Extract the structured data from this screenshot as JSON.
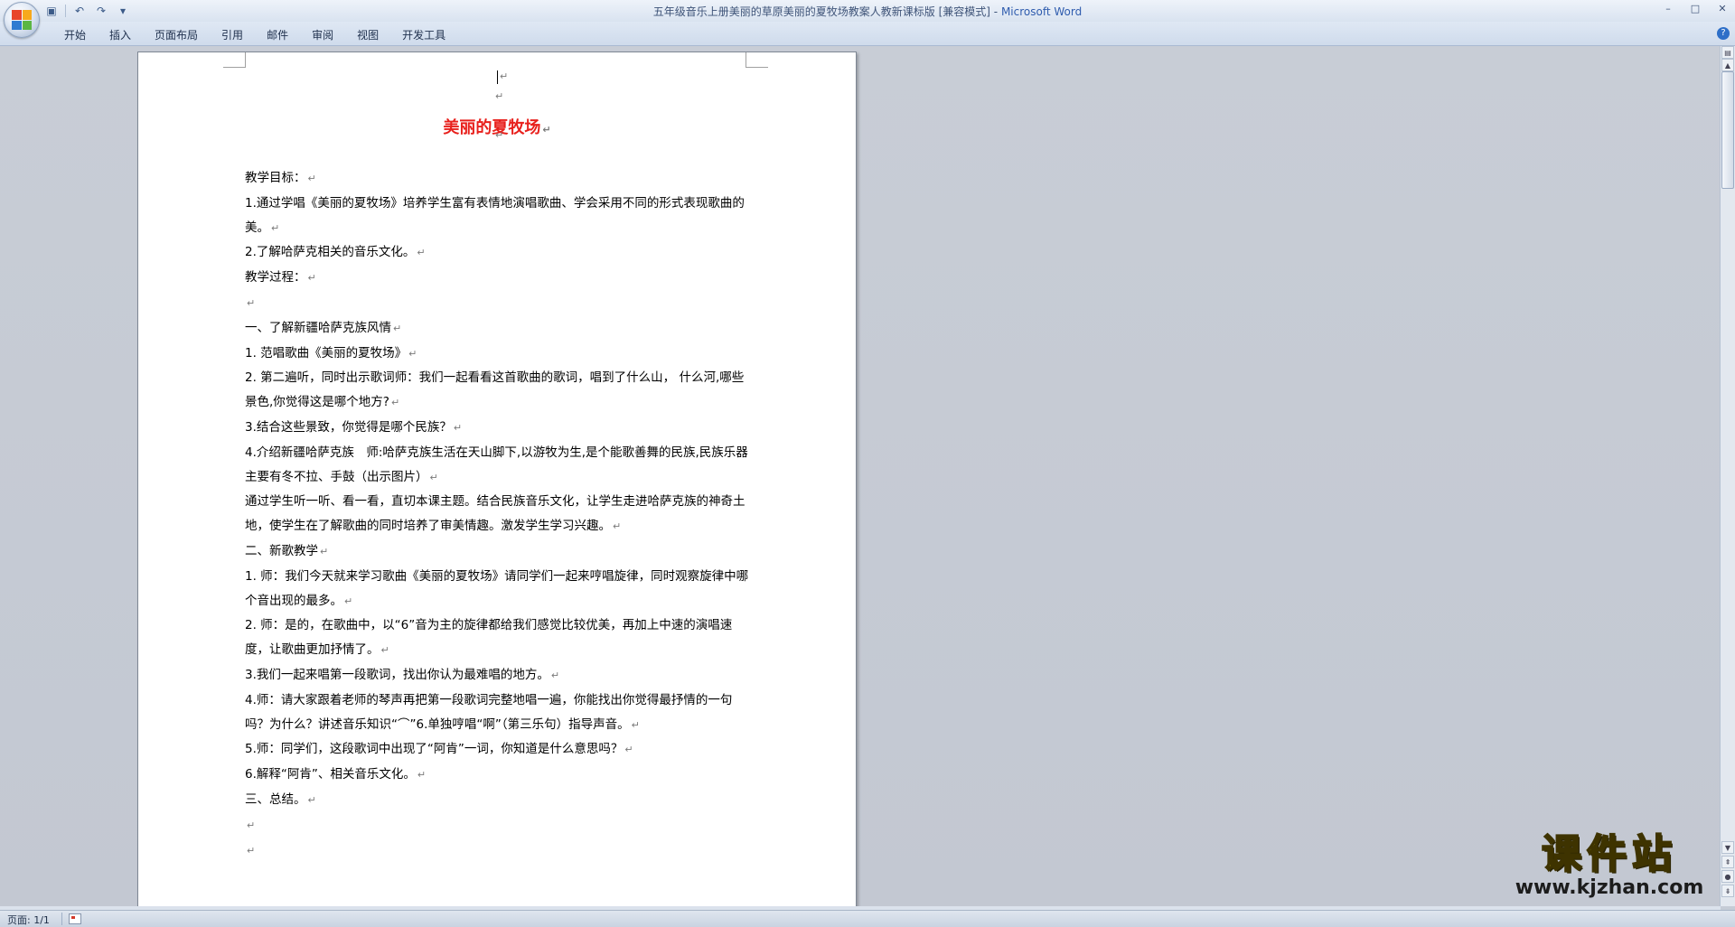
{
  "window": {
    "title": "五年级音乐上册美丽的草原美丽的夏牧场教案人教新课标版 [兼容模式] -",
    "app_name": "Microsoft Word"
  },
  "qat": {
    "save_icon": "save-icon",
    "undo_icon": "undo-icon",
    "redo_icon": "redo-icon",
    "customize_icon": "qat-dropdown-icon"
  },
  "ribbon_tabs": [
    "开始",
    "插入",
    "页面布局",
    "引用",
    "邮件",
    "审阅",
    "视图",
    "开发工具"
  ],
  "document": {
    "title": "美丽的夏牧场",
    "paragraphs": [
      "教学目标：",
      "1.通过学唱《美丽的夏牧场》培养学生富有表情地演唱歌曲、学会采用不同的形式表现歌曲的美。",
      "2.了解哈萨克相关的音乐文化。",
      "教学过程：",
      "",
      "一、了解新疆哈萨克族风情",
      "1. 范唱歌曲《美丽的夏牧场》",
      "2. 第二遍听，同时出示歌词师：我们一起看看这首歌曲的歌词，唱到了什么山， 什么河,哪些景色,你觉得这是哪个地方?",
      "3.结合这些景致，你觉得是哪个民族？",
      "4.介绍新疆哈萨克族　师:哈萨克族生活在天山脚下,以游牧为生,是个能歌善舞的民族,民族乐器主要有冬不拉、手鼓（出示图片）",
      "通过学生听一听、看一看，直切本课主题。结合民族音乐文化，让学生走进哈萨克族的神奇土地，使学生在了解歌曲的同时培养了审美情趣。激发学生学习兴趣。",
      "二、新歌教学",
      "1. 师：我们今天就来学习歌曲《美丽的夏牧场》请同学们一起来哼唱旋律，同时观察旋律中哪个音出现的最多。",
      "2. 师：是的，在歌曲中，以“6”音为主的旋律都给我们感觉比较优美，再加上中速的演唱速度，让歌曲更加抒情了。",
      "3.我们一起来唱第一段歌词，找出你认为最难唱的地方。",
      "4.师：请大家跟着老师的琴声再把第一段歌词完整地唱一遍，你能找出你觉得最抒情的一句吗？为什么？讲述音乐知识“⌒”6.单独哼唱“啊”（第三乐句）指导声音。",
      "5.师：同学们，这段歌词中出现了“阿肯”一词，你知道是什么意思吗？",
      "6.解释“阿肯”、相关音乐文化。",
      "三、总结。",
      "",
      ""
    ]
  },
  "status": {
    "page": "页面: 1/1"
  },
  "watermark": {
    "main": "课件站",
    "url": "www.kjzhan.com"
  }
}
